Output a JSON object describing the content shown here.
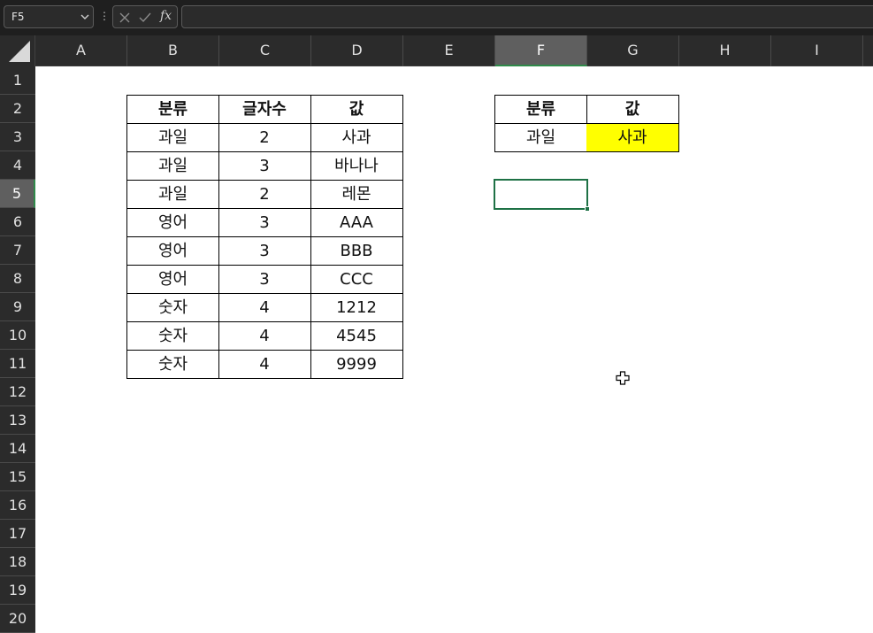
{
  "namebox": {
    "value": "F5"
  },
  "formula_bar": {
    "cancel_icon": "x-icon",
    "enter_icon": "check-icon",
    "fx_label": "fx",
    "content": ""
  },
  "columns": [
    "A",
    "B",
    "C",
    "D",
    "E",
    "F",
    "G",
    "H",
    "I"
  ],
  "selected_column": "F",
  "rows": [
    "1",
    "2",
    "3",
    "4",
    "5",
    "6",
    "7",
    "8",
    "9",
    "10",
    "11",
    "12",
    "13",
    "14",
    "15",
    "16",
    "17",
    "18",
    "19",
    "20"
  ],
  "selected_row": "5",
  "table_left": {
    "headers": [
      "분류",
      "글자수",
      "값"
    ],
    "rows": [
      [
        "과일",
        "2",
        "사과"
      ],
      [
        "과일",
        "3",
        "바나나"
      ],
      [
        "과일",
        "2",
        "레몬"
      ],
      [
        "영어",
        "3",
        "AAA"
      ],
      [
        "영어",
        "3",
        "BBB"
      ],
      [
        "영어",
        "3",
        "CCC"
      ],
      [
        "숫자",
        "4",
        "1212"
      ],
      [
        "숫자",
        "4",
        "4545"
      ],
      [
        "숫자",
        "4",
        "9999"
      ]
    ]
  },
  "table_right": {
    "headers": [
      "분류",
      "값"
    ],
    "row": [
      "과일",
      "사과"
    ],
    "highlight_color": "#ffff00"
  },
  "active_cell": "F5",
  "colors": {
    "selection_green": "#1e7145",
    "header_bg": "#2b2b2b"
  }
}
